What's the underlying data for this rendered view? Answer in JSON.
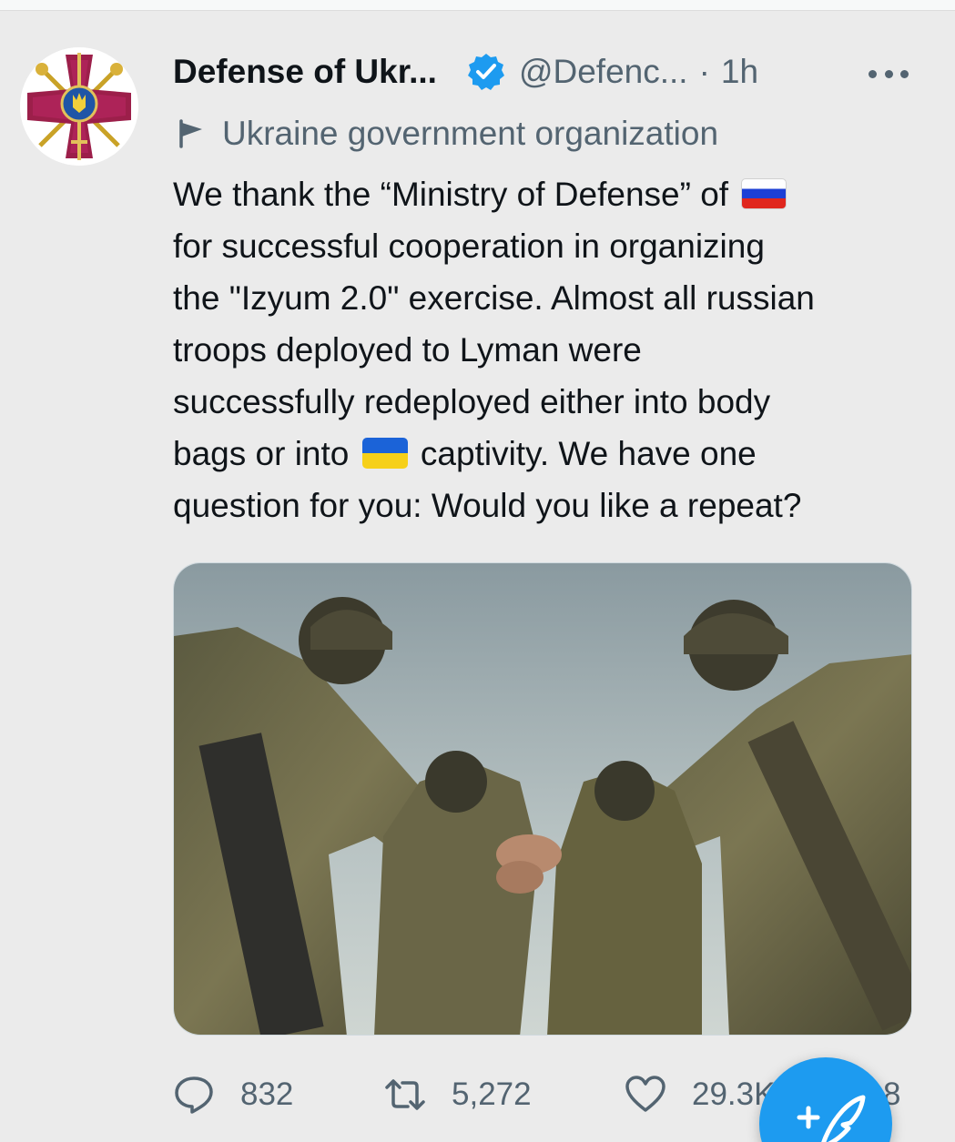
{
  "tweet": {
    "display_name": "Defense of Ukr...",
    "handle": "@Defenc...",
    "separator": "·",
    "time": "1h",
    "label": "Ukraine government organization",
    "text_lines": [
      "We thank the “Ministry of Defense” of",
      "for successful cooperation in organizing",
      "the \"Izyum 2.0\" exercise. Almost all russian",
      "troops deployed to Lyman were",
      "successfully redeployed either into body",
      "bags or into",
      "captivity. We have one",
      "question for you: Would you like a repeat?"
    ],
    "flags": {
      "after_line_1": "russia-flag",
      "inline_line_6": "ukraine-flag"
    }
  },
  "actions": {
    "replies": "832",
    "retweets": "5,272",
    "likes": "29.3K",
    "views_partial": "8"
  },
  "icons": {
    "verified": "verified-badge-icon",
    "more": "more-dots-icon",
    "label": "flag-icon",
    "reply": "reply-icon",
    "retweet": "retweet-icon",
    "like": "heart-icon",
    "compose": "compose-feather-icon"
  },
  "colors": {
    "accent": "#1d9bf0",
    "text": "#0f1419",
    "secondary": "#536471",
    "background": "#ebebeb"
  }
}
